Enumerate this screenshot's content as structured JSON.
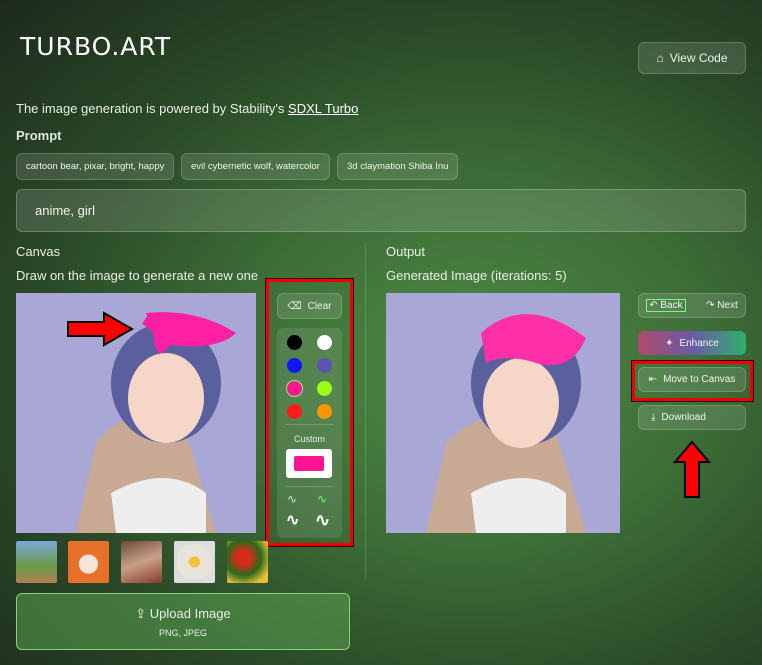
{
  "header": {
    "logo": "TURBO.ART",
    "view_code": "View Code",
    "powered_prefix": "The image generation is powered by Stability's ",
    "powered_link": "SDXL Turbo"
  },
  "prompt": {
    "label": "Prompt",
    "chips": [
      "cartoon bear, pixar, bright, happy",
      "evil cybernetic wolf, watercolor",
      "3d claymation Shiba Inu"
    ],
    "value": "anime, girl"
  },
  "canvas": {
    "label": "Canvas",
    "hint": "Draw on the image to generate a new one",
    "clear": "Clear",
    "custom_label": "Custom",
    "custom_color": "#ff1493",
    "colors": [
      "#000000",
      "#ffffff",
      "#1414ff",
      "#5a55b5",
      "#ff1493",
      "#9aff14",
      "#ff1a1a",
      "#ff9500"
    ],
    "selected_color": "#ff1493",
    "upload": "Upload Image",
    "upload_formats": "PNG, JPEG"
  },
  "output": {
    "label": "Output",
    "generated": "Generated Image (iterations: 5)",
    "back": "Back",
    "next": "Next",
    "enhance": "Enhance",
    "move_to_canvas": "Move to Canvas",
    "download": "Download"
  }
}
